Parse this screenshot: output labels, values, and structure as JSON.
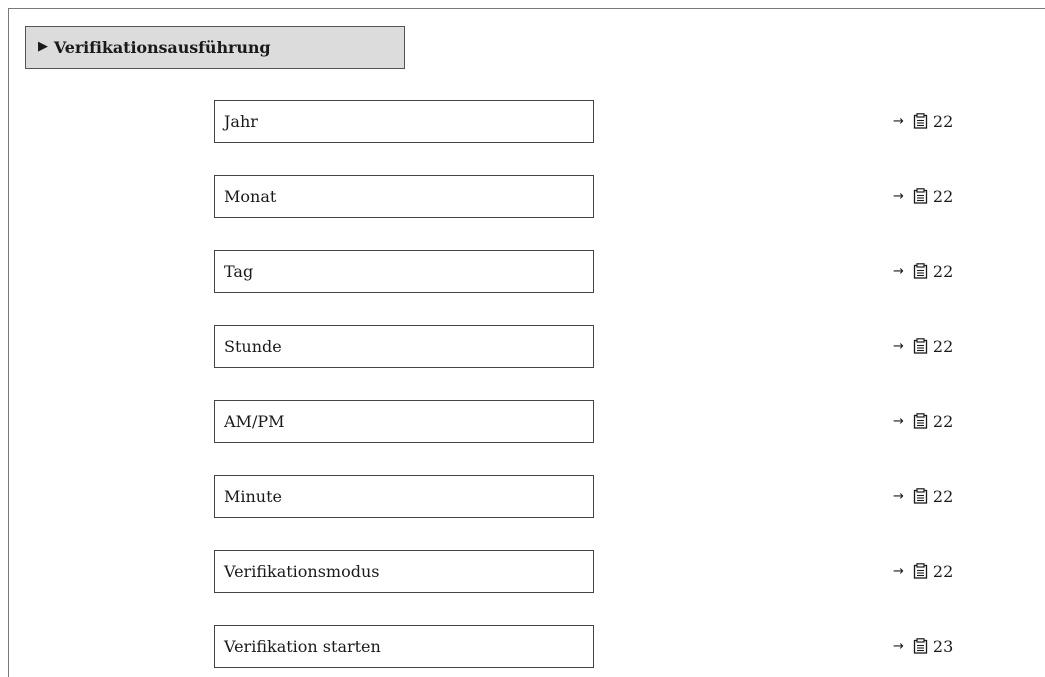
{
  "section": {
    "title": "Verifikationsausführung",
    "marker": "▶"
  },
  "items": [
    {
      "label": "Jahr",
      "arrow": "→",
      "page": "22"
    },
    {
      "label": "Monat",
      "arrow": "→",
      "page": "22"
    },
    {
      "label": "Tag",
      "arrow": "→",
      "page": "22"
    },
    {
      "label": "Stunde",
      "arrow": "→",
      "page": "22"
    },
    {
      "label": "AM/PM",
      "arrow": "→",
      "page": "22"
    },
    {
      "label": "Minute",
      "arrow": "→",
      "page": "22"
    },
    {
      "label": "Verifikationsmodus",
      "arrow": "→",
      "page": "22"
    },
    {
      "label": "Verifikation starten",
      "arrow": "→",
      "page": "23"
    }
  ],
  "icons": {
    "page_reference": "document-icon"
  }
}
